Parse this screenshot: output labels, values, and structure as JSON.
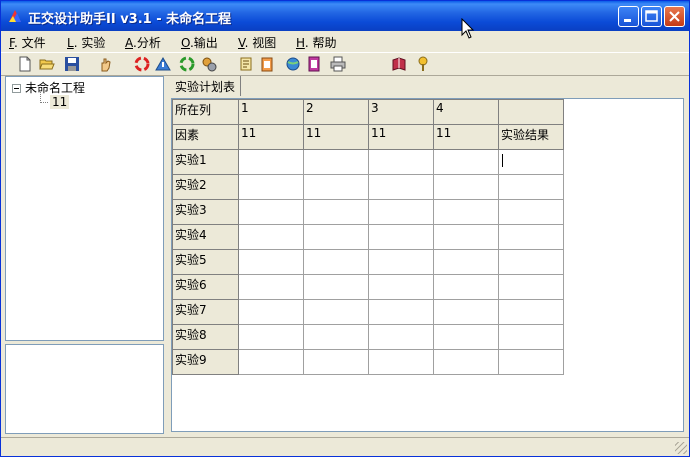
{
  "window": {
    "title": "正交设计助手II v3.1 - 未命名工程"
  },
  "menu": [
    {
      "accel": "F",
      "label": ". 文件"
    },
    {
      "accel": "L",
      "label": ". 实验"
    },
    {
      "accel": "A",
      "label": ".分析"
    },
    {
      "accel": "O",
      "label": ".输出"
    },
    {
      "accel": "V",
      "label": ". 视图"
    },
    {
      "accel": "H",
      "label": ". 帮助"
    }
  ],
  "toolbar": {
    "icons": [
      "new-file-icon",
      "open-folder-icon",
      "save-icon",
      "hand-icon",
      "recycle-red-icon",
      "warning-triangle-icon",
      "recycle-green-icon",
      "gears-icon",
      "scroll-icon",
      "notepad-icon",
      "globe-icon",
      "document-icon",
      "print-icon",
      "book-icon",
      "help-pin-icon"
    ]
  },
  "tree": {
    "root": "未命名工程",
    "child": "11"
  },
  "tab": {
    "label": "实验计划表"
  },
  "sheet": {
    "header_row_label": "所在列",
    "columns": [
      "1",
      "2",
      "3",
      "4",
      ""
    ],
    "factor_row_label": "因素",
    "factors": [
      "11",
      "11",
      "11",
      "11",
      "实验结果"
    ],
    "rows": [
      "实验1",
      "实验2",
      "实验3",
      "实验4",
      "实验5",
      "实验6",
      "实验7",
      "实验8",
      "实验9"
    ]
  },
  "colors": {
    "titlebar": "#0a4bd7",
    "chrome": "#ece9d8",
    "panel_border": "#7f9db9"
  }
}
